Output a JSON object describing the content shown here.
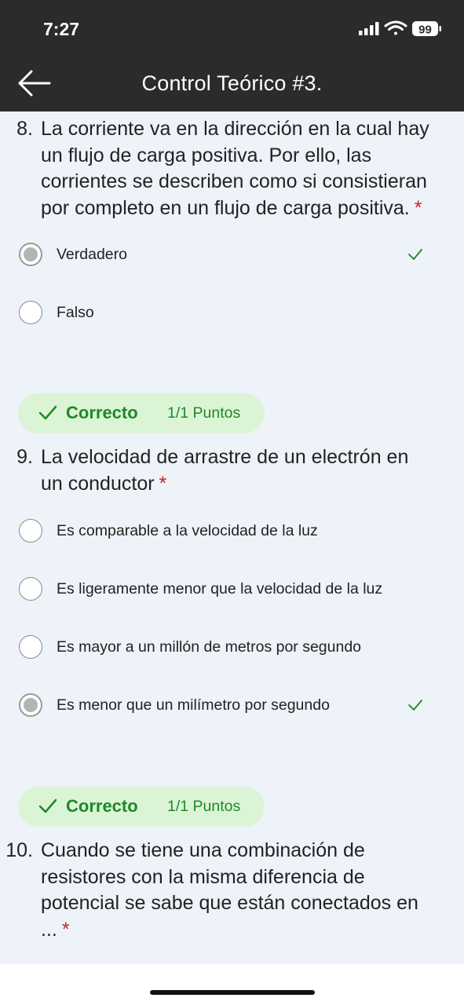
{
  "status_bar": {
    "time": "7:27",
    "battery": "99"
  },
  "nav": {
    "title": "Control Teórico #3."
  },
  "questions": [
    {
      "number": "8.",
      "lines": [
        "La corriente va en la dirección en la cual hay",
        "un flujo de carga positiva. Por ello, las",
        "corrientes se describen como si consistieran",
        "por completo en un flujo de carga positiva."
      ],
      "required": "*",
      "options": [
        {
          "label": "Verdadero",
          "selected": true,
          "correct": true
        },
        {
          "label": "Falso",
          "selected": false,
          "correct": false
        }
      ],
      "result": {
        "status": "Correcto",
        "points": "1/1 Puntos"
      }
    },
    {
      "number": "9.",
      "lines": [
        "La velocidad de arrastre de un electrón en",
        "un conductor"
      ],
      "required": "*",
      "options": [
        {
          "label": "Es comparable a la velocidad de la luz",
          "selected": false,
          "correct": false
        },
        {
          "label": "Es ligeramente menor que la velocidad de la luz",
          "selected": false,
          "correct": false
        },
        {
          "label": "Es mayor a un millón de metros por segundo",
          "selected": false,
          "correct": false
        },
        {
          "label": "Es menor que un milímetro por segundo",
          "selected": true,
          "correct": true
        }
      ],
      "result": {
        "status": "Correcto",
        "points": "1/1 Puntos"
      }
    },
    {
      "number": "10.",
      "lines": [
        "Cuando se tiene una combinación de",
        "resistores con la misma diferencia de",
        "potencial se sabe que están conectados en",
        "..."
      ],
      "required": "*"
    }
  ],
  "colors": {
    "correct_green": "#1c8a26",
    "pill_bg": "#dcf4d6",
    "required_red": "#c0262d",
    "content_bg": "#eef2f9"
  }
}
